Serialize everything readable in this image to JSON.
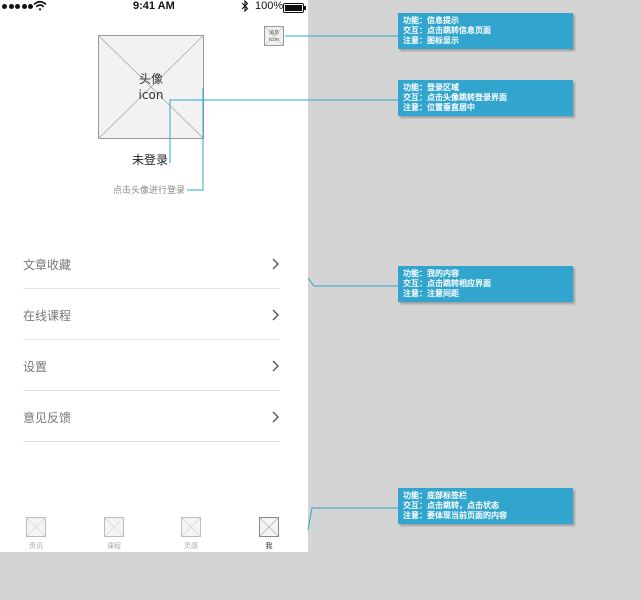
{
  "status_bar": {
    "time": "9:41 AM",
    "battery": "100%"
  },
  "message_icon": {
    "line1": "消息",
    "line2": "icon"
  },
  "avatar": {
    "line1": "头像",
    "line2": "icon"
  },
  "login": {
    "status": "未登录",
    "hint": "点击头像进行登录"
  },
  "menu": [
    {
      "label": "文章收藏"
    },
    {
      "label": "在线课程"
    },
    {
      "label": "设置"
    },
    {
      "label": "意见反馈"
    }
  ],
  "tabbar": [
    {
      "label": "资讯",
      "icon": "icon"
    },
    {
      "label": "课程",
      "icon": "icon"
    },
    {
      "label": "灵感",
      "icon": "icon"
    },
    {
      "label": "我",
      "icon": "icon"
    }
  ],
  "annotations": [
    {
      "lines": [
        "功能：信息提示",
        "交互：点击跳转信息页面",
        "注意：图标显示"
      ]
    },
    {
      "lines": [
        "功能：登录区域",
        "交互：点击头像跳转登录界面",
        "注意：位置垂直居中"
      ]
    },
    {
      "lines": [
        "功能：我的内容",
        "交互：点击跳转相应界面",
        "注意：注意间距"
      ]
    },
    {
      "lines": [
        "功能：底部标签栏",
        "交互：点击跳转，点击状态",
        "注意：要体现当前页面的内容"
      ]
    }
  ],
  "colors": {
    "annotation": "#31a5ce",
    "canvas": "#d4d4d4",
    "phone": "#ffffff"
  }
}
